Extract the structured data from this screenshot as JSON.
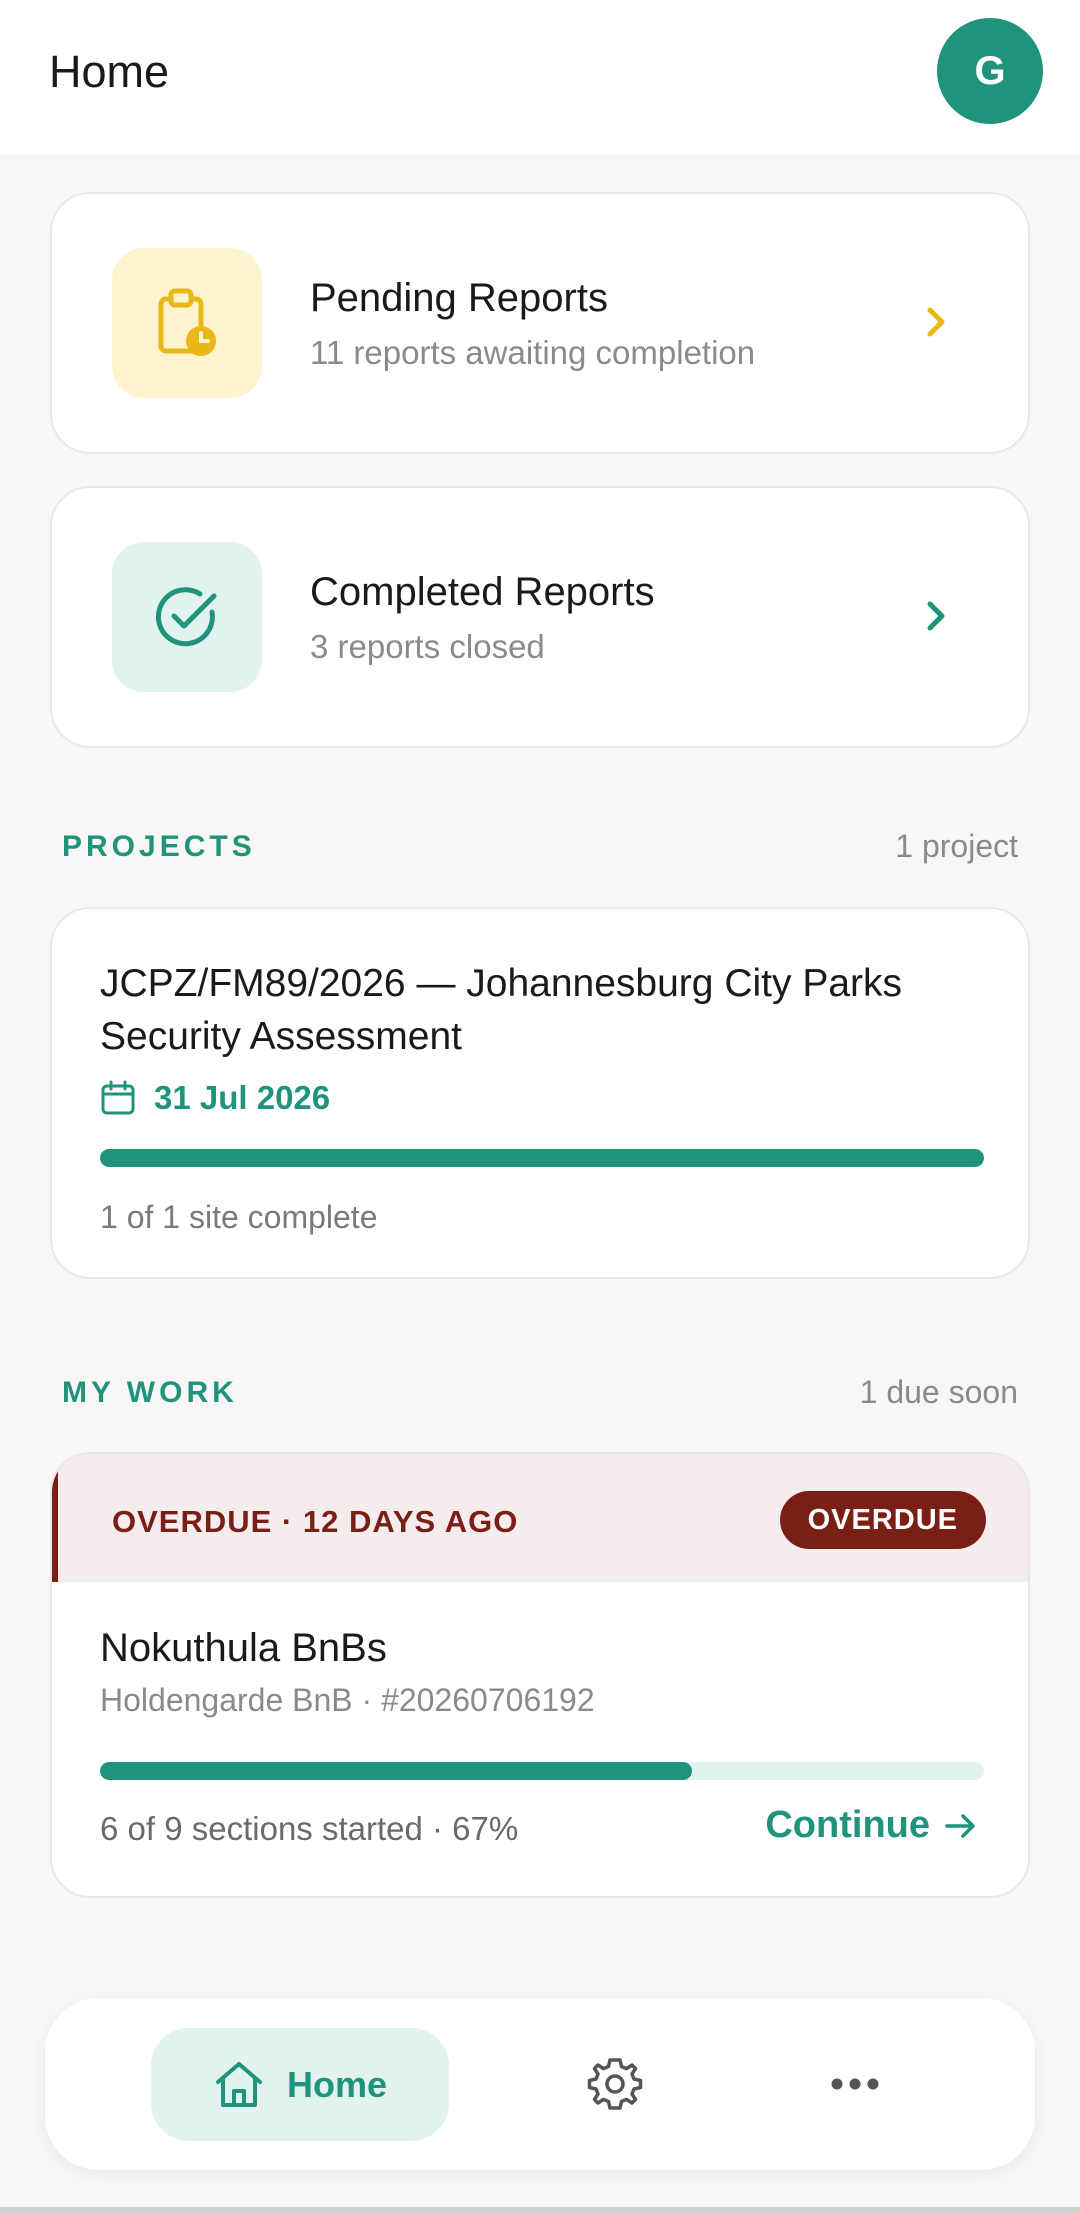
{
  "header": {
    "title": "Home",
    "avatar_initial": "G",
    "avatar_color": "#1f937b"
  },
  "reports": {
    "pending": {
      "title": "Pending Reports",
      "subtitle": "11 reports awaiting completion",
      "icon": "clipboard-clock-icon",
      "accent": "#e8b817"
    },
    "completed": {
      "title": "Completed Reports",
      "subtitle": "3 reports closed",
      "icon": "check-circle-icon",
      "accent": "#1f937b"
    }
  },
  "projects": {
    "label": "PROJECTS",
    "count_text": "1 project",
    "items": [
      {
        "title": "JCPZ/FM89/2026 — Johannesburg City Parks Security Assessment",
        "date": "31 Jul 2026",
        "progress": 1.0,
        "status": "1 of 1 site complete"
      }
    ]
  },
  "my_work": {
    "label": "MY WORK",
    "count_text": "1 due soon",
    "items": [
      {
        "banner": "OVERDUE · 12 DAYS AGO",
        "badge": "OVERDUE",
        "title": "Nokuthula BnBs",
        "subtitle": "Holdengarde BnB · #20260706192",
        "progress": 0.67,
        "status": "6 of 9 sections started · 67%",
        "action": "Continue",
        "danger_color": "#7a1f16"
      }
    ]
  },
  "nav": {
    "home_label": "Home",
    "home_icon": "home-icon",
    "settings_icon": "gear-icon",
    "more_icon": "more-dots-icon"
  },
  "theme": {
    "primary": "#1f937b",
    "background": "#f8f7f5"
  }
}
